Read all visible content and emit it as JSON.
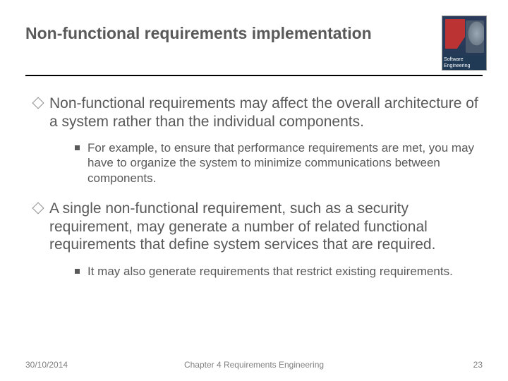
{
  "title": "Non-functional requirements implementation",
  "book_cover_label": "Software Engineering",
  "bullets": [
    {
      "text": "Non-functional requirements may affect the overall architecture of a system rather than the individual components.",
      "sub": [
        "For example, to ensure that performance requirements are met, you may have to organize the system to minimize communications between components."
      ]
    },
    {
      "text": "A single non-functional requirement, such as a security requirement, may generate a number of related functional requirements that define system services that are required.",
      "sub": [
        "It may also generate requirements that restrict existing requirements."
      ]
    }
  ],
  "footer": {
    "date": "30/10/2014",
    "center": "Chapter 4 Requirements Engineering",
    "page": "23"
  }
}
